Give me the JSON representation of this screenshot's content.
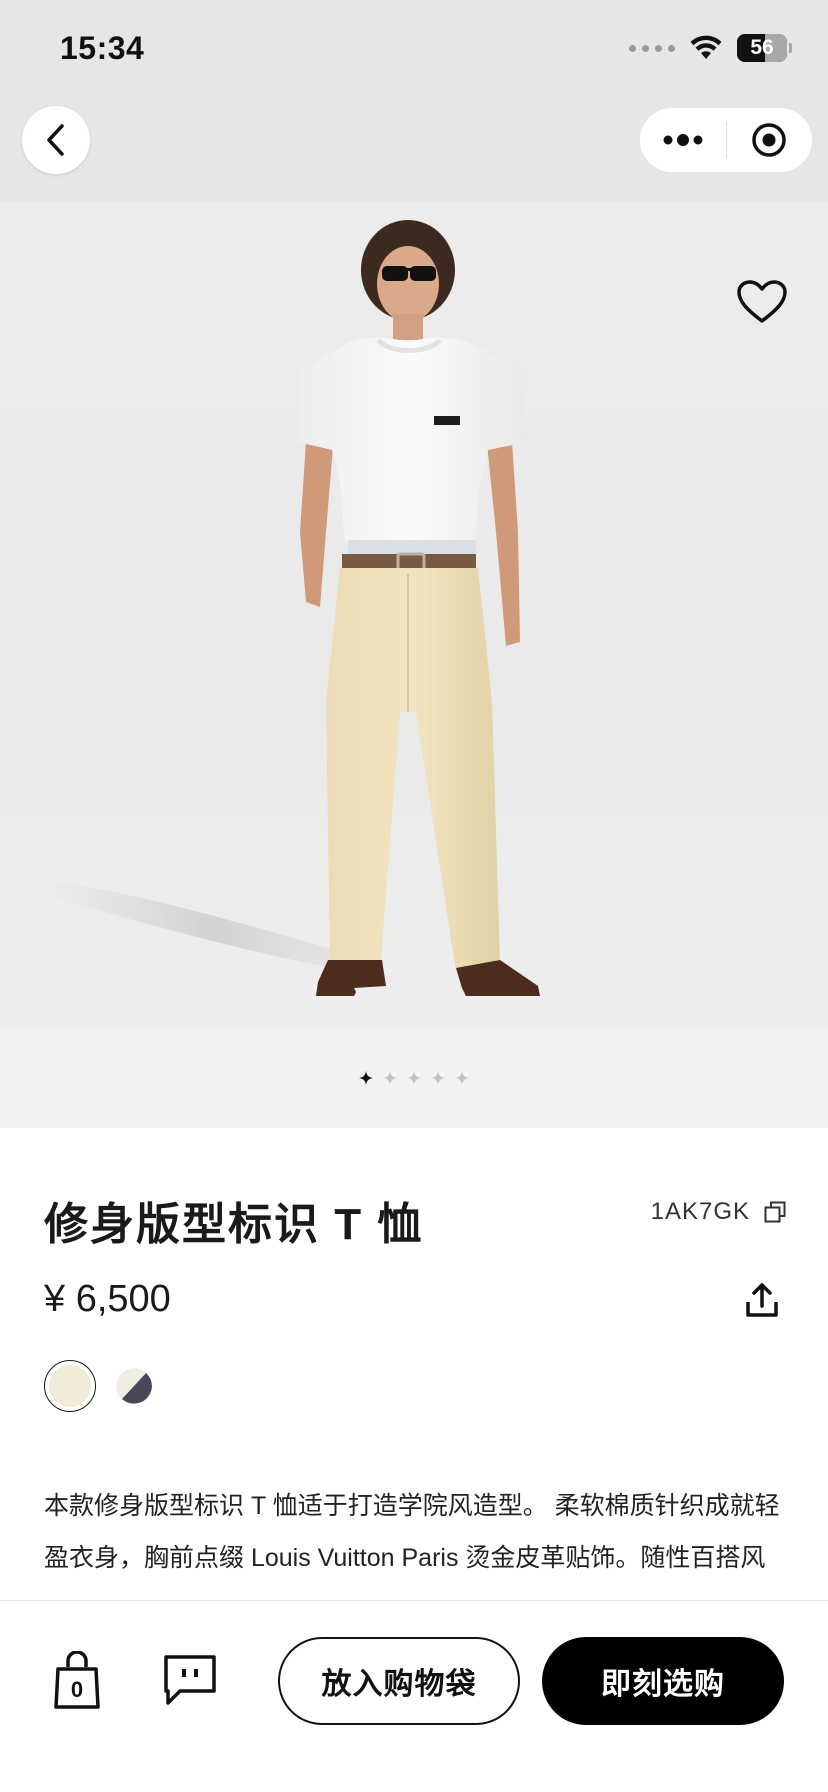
{
  "status_bar": {
    "time": "15:34",
    "battery": "56",
    "battery_level": 0.56,
    "icons": [
      "cellular-dots-icon",
      "wifi-icon",
      "battery-icon"
    ]
  },
  "nav": {
    "back_icon": "chevron-left-icon",
    "more_icon": "more-dots-icon",
    "close_icon": "target-circle-icon"
  },
  "hero": {
    "favorite_icon": "heart-outline-icon",
    "slide_count": 5,
    "active_slide": 1
  },
  "product": {
    "title": "修身版型标识 T 恤",
    "sku": "1AK7GK",
    "copy_icon": "copy-icon",
    "price": "¥ 6,500",
    "share_icon": "share-icon",
    "swatches": [
      {
        "color": "#f2ead8",
        "selected": true
      },
      {
        "colors": [
          "#f0ede6",
          "#4a4858"
        ],
        "selected": false
      }
    ],
    "description": "本款修身版型标识 T 恤适于打造学院风造型。 柔软棉质针织成就轻盈衣身，胸前点缀 Louis Vuitton Paris 烫金皮革贴饰。随性百搭风"
  },
  "actions": {
    "bag_count": "0",
    "bag_icon": "shopping-bag-icon",
    "chat_icon": "chat-bubble-icon",
    "add_to_bag": "放入购物袋",
    "buy_now": "即刻选购"
  },
  "colors": {
    "header_bg": "#e6e6e6",
    "hero_bg": "#ececec",
    "primary": "#000000"
  }
}
